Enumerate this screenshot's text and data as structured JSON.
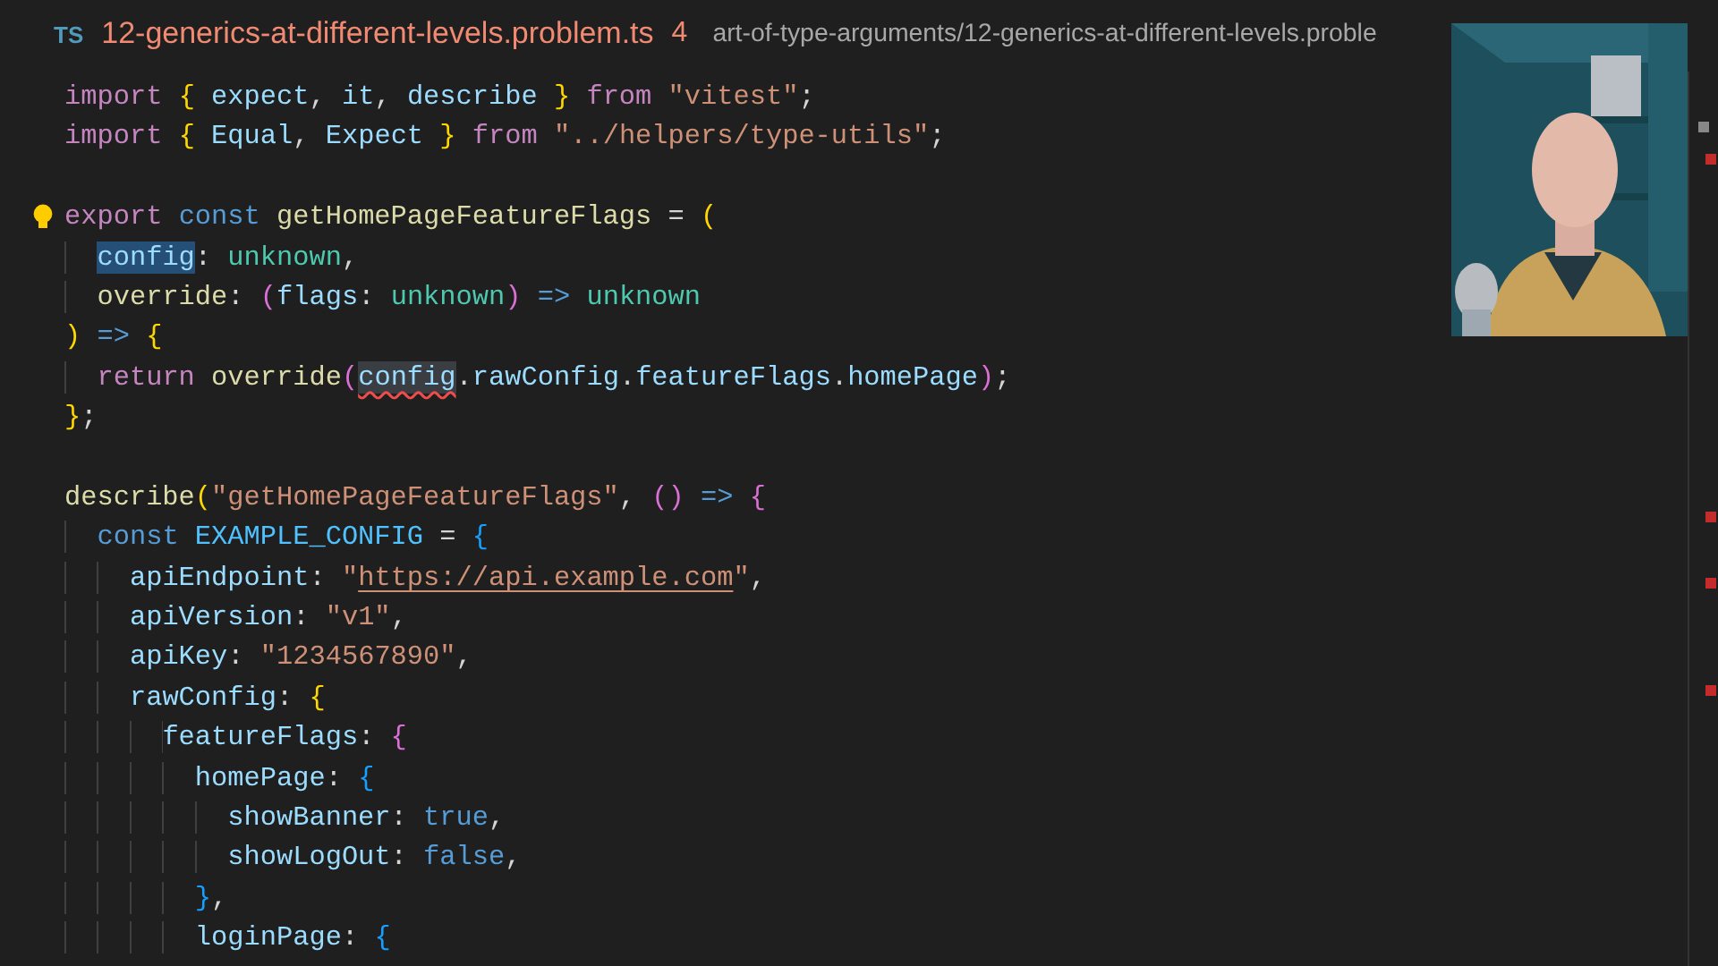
{
  "editor_header": {
    "file_type": "TS",
    "file_name": "12-generics-at-different-levels.problem.ts",
    "problem_count": "4",
    "breadcrumb": "art-of-type-arguments/12-generics-at-different-levels.proble"
  },
  "code_lines": [
    {
      "kind": "code",
      "tokens": [
        {
          "kind": "kw",
          "text": "import "
        },
        {
          "kind": "b1",
          "text": "{ "
        },
        {
          "kind": "var",
          "text": "expect"
        },
        {
          "kind": "p",
          "text": ", "
        },
        {
          "kind": "var",
          "text": "it"
        },
        {
          "kind": "p",
          "text": ", "
        },
        {
          "kind": "var",
          "text": "describe "
        },
        {
          "kind": "b1",
          "text": "} "
        },
        {
          "kind": "kw",
          "text": "from "
        },
        {
          "kind": "str",
          "text": "\"vitest\""
        },
        {
          "kind": "p",
          "text": ";"
        }
      ]
    },
    {
      "kind": "code",
      "tokens": [
        {
          "kind": "kw",
          "text": "import "
        },
        {
          "kind": "b1",
          "text": "{ "
        },
        {
          "kind": "var",
          "text": "Equal"
        },
        {
          "kind": "p",
          "text": ", "
        },
        {
          "kind": "var",
          "text": "Expect "
        },
        {
          "kind": "b1",
          "text": "} "
        },
        {
          "kind": "kw",
          "text": "from "
        },
        {
          "kind": "str",
          "text": "\"../helpers/type-utils\""
        },
        {
          "kind": "p",
          "text": ";"
        }
      ]
    },
    {
      "kind": "blank"
    },
    {
      "kind": "code",
      "tokens": [
        {
          "kind": "kw",
          "text": "export "
        },
        {
          "kind": "storage",
          "text": "const "
        },
        {
          "kind": "fn",
          "text": "getHomePageFeatureFlags"
        },
        {
          "kind": "p",
          "text": " = "
        },
        {
          "kind": "b1",
          "text": "("
        }
      ]
    },
    {
      "kind": "code",
      "tokens": [
        {
          "kind": "var",
          "text": "  config",
          "highlighted": true
        },
        {
          "kind": "p",
          "text": ": "
        },
        {
          "kind": "type",
          "text": "unknown"
        },
        {
          "kind": "p",
          "text": ","
        }
      ]
    },
    {
      "kind": "code",
      "tokens": [
        {
          "kind": "fn",
          "text": "  override"
        },
        {
          "kind": "p",
          "text": ": "
        },
        {
          "kind": "b2",
          "text": "("
        },
        {
          "kind": "var",
          "text": "flags"
        },
        {
          "kind": "p",
          "text": ": "
        },
        {
          "kind": "type",
          "text": "unknown"
        },
        {
          "kind": "b2",
          "text": ") "
        },
        {
          "kind": "storage",
          "text": "=> "
        },
        {
          "kind": "type",
          "text": "unknown"
        }
      ]
    },
    {
      "kind": "code",
      "tokens": [
        {
          "kind": "b1",
          "text": ") "
        },
        {
          "kind": "storage",
          "text": "=> "
        },
        {
          "kind": "b1",
          "text": "{"
        }
      ]
    },
    {
      "kind": "code",
      "tokens": [
        {
          "kind": "kw",
          "text": "  return "
        },
        {
          "kind": "fn",
          "text": "override"
        },
        {
          "kind": "b2",
          "text": "("
        },
        {
          "kind": "var",
          "text": "config",
          "highlighted": true,
          "error": true
        },
        {
          "kind": "p",
          "text": "."
        },
        {
          "kind": "var",
          "text": "rawConfig"
        },
        {
          "kind": "p",
          "text": "."
        },
        {
          "kind": "var",
          "text": "featureFlags"
        },
        {
          "kind": "p",
          "text": "."
        },
        {
          "kind": "var",
          "text": "homePage"
        },
        {
          "kind": "b2",
          "text": ")"
        },
        {
          "kind": "p",
          "text": ";"
        }
      ]
    },
    {
      "kind": "code",
      "tokens": [
        {
          "kind": "b1",
          "text": "}"
        },
        {
          "kind": "p",
          "text": ";"
        }
      ]
    },
    {
      "kind": "blank"
    },
    {
      "kind": "code",
      "tokens": [
        {
          "kind": "fn",
          "text": "describe"
        },
        {
          "kind": "b1",
          "text": "("
        },
        {
          "kind": "str",
          "text": "\"getHomePageFeatureFlags\""
        },
        {
          "kind": "p",
          "text": ", "
        },
        {
          "kind": "b2",
          "text": "() "
        },
        {
          "kind": "storage",
          "text": "=> "
        },
        {
          "kind": "b2",
          "text": "{"
        }
      ]
    },
    {
      "kind": "code",
      "tokens": [
        {
          "kind": "storage",
          "text": "  const "
        },
        {
          "kind": "const",
          "text": "EXAMPLE_CONFIG"
        },
        {
          "kind": "p",
          "text": " = "
        },
        {
          "kind": "b3",
          "text": "{"
        }
      ]
    },
    {
      "kind": "code",
      "tokens": [
        {
          "kind": "var",
          "text": "    apiEndpoint"
        },
        {
          "kind": "p",
          "text": ": "
        },
        {
          "kind": "str",
          "text": "\""
        },
        {
          "kind": "link",
          "text": "https://api.example.com"
        },
        {
          "kind": "str",
          "text": "\""
        },
        {
          "kind": "p",
          "text": ","
        }
      ]
    },
    {
      "kind": "code",
      "tokens": [
        {
          "kind": "var",
          "text": "    apiVersion"
        },
        {
          "kind": "p",
          "text": ": "
        },
        {
          "kind": "str",
          "text": "\"v1\""
        },
        {
          "kind": "p",
          "text": ","
        }
      ]
    },
    {
      "kind": "code",
      "tokens": [
        {
          "kind": "var",
          "text": "    apiKey"
        },
        {
          "kind": "p",
          "text": ": "
        },
        {
          "kind": "str",
          "text": "\"1234567890\""
        },
        {
          "kind": "p",
          "text": ","
        }
      ]
    },
    {
      "kind": "code",
      "tokens": [
        {
          "kind": "var",
          "text": "    rawConfig"
        },
        {
          "kind": "p",
          "text": ": "
        },
        {
          "kind": "b1",
          "text": "{"
        }
      ]
    },
    {
      "kind": "code",
      "tokens": [
        {
          "kind": "var",
          "text": "      featureFlags"
        },
        {
          "kind": "p",
          "text": ": "
        },
        {
          "kind": "b2",
          "text": "{"
        }
      ]
    },
    {
      "kind": "code",
      "tokens": [
        {
          "kind": "var",
          "text": "        homePage"
        },
        {
          "kind": "p",
          "text": ": "
        },
        {
          "kind": "b3",
          "text": "{"
        }
      ]
    },
    {
      "kind": "code",
      "tokens": [
        {
          "kind": "var",
          "text": "          showBanner"
        },
        {
          "kind": "p",
          "text": ": "
        },
        {
          "kind": "bool",
          "text": "true"
        },
        {
          "kind": "p",
          "text": ","
        }
      ]
    },
    {
      "kind": "code",
      "tokens": [
        {
          "kind": "var",
          "text": "          showLogOut"
        },
        {
          "kind": "p",
          "text": ": "
        },
        {
          "kind": "bool",
          "text": "false"
        },
        {
          "kind": "p",
          "text": ","
        }
      ]
    },
    {
      "kind": "code",
      "tokens": [
        {
          "kind": "b3",
          "text": "        }"
        },
        {
          "kind": "p",
          "text": ","
        }
      ]
    },
    {
      "kind": "code",
      "tokens": [
        {
          "kind": "var",
          "text": "        loginPage"
        },
        {
          "kind": "p",
          "text": ": "
        },
        {
          "kind": "b3",
          "text": "{"
        }
      ]
    }
  ]
}
